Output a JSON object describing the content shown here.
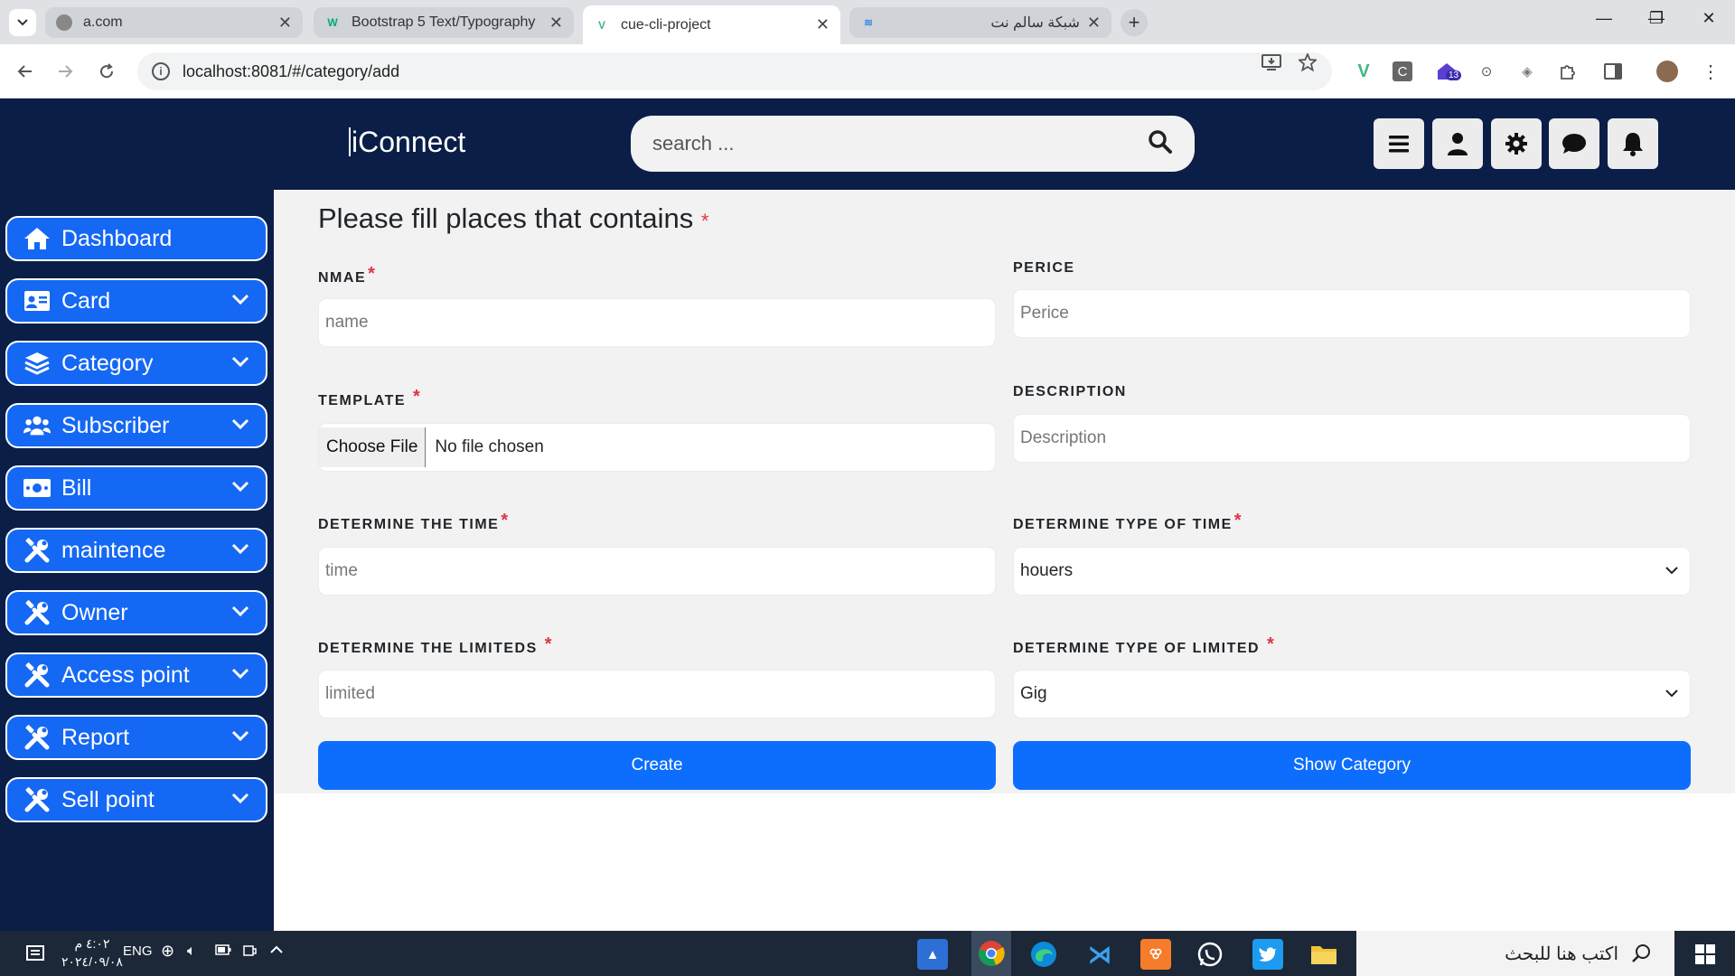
{
  "browser": {
    "tabs": [
      {
        "title": "a.com",
        "active": false,
        "favicon": "globe-icon"
      },
      {
        "title": "Bootstrap 5 Text/Typography",
        "active": false,
        "favicon": "w3schools-icon"
      },
      {
        "title": "cue-cli-project",
        "active": true,
        "favicon": "vue-icon"
      },
      {
        "title": "شبكة سالم نت",
        "active": false,
        "favicon": "wifi-icon"
      }
    ],
    "url": "localhost:8081/#/category/add",
    "extension_badge": "13"
  },
  "header": {
    "brand": "iConnect",
    "search_placeholder": "search ...",
    "buttons": [
      "menu-icon",
      "user-icon",
      "gear-icon",
      "chat-icon",
      "bell-icon"
    ]
  },
  "sidebar": {
    "items": [
      {
        "label": "Dashboard",
        "icon": "home-icon",
        "has_chevron": false
      },
      {
        "label": "Card",
        "icon": "id-card-icon",
        "has_chevron": true
      },
      {
        "label": "Category",
        "icon": "layers-icon",
        "has_chevron": true
      },
      {
        "label": "Subscriber",
        "icon": "users-icon",
        "has_chevron": true
      },
      {
        "label": "Bill",
        "icon": "money-icon",
        "has_chevron": true
      },
      {
        "label": "maintence",
        "icon": "tools-icon",
        "has_chevron": true
      },
      {
        "label": "Owner",
        "icon": "tools-icon",
        "has_chevron": true
      },
      {
        "label": "Access point",
        "icon": "tools-icon",
        "has_chevron": true
      },
      {
        "label": "Report",
        "icon": "tools-icon",
        "has_chevron": true
      },
      {
        "label": "Sell point",
        "icon": "tools-icon",
        "has_chevron": true
      }
    ]
  },
  "form": {
    "heading": "Please fill places that contains",
    "required_mark": "*",
    "fields": {
      "name": {
        "label": "NMAE",
        "placeholder": "name",
        "required": true
      },
      "price": {
        "label": "PERICE",
        "placeholder": "Perice",
        "required": false
      },
      "template": {
        "label": "TEMPLATE",
        "file_button": "Choose File",
        "file_status": "No file chosen",
        "required": true
      },
      "description": {
        "label": "DESCRIPTION",
        "placeholder": "Description",
        "required": false
      },
      "time": {
        "label": "DETERMINE THE TIME",
        "placeholder": "time",
        "required": true
      },
      "time_type": {
        "label": "DETERMINE TYPE OF TIME",
        "value": "houers",
        "required": true
      },
      "limited": {
        "label": "DETERMINE THE LIMITEDS",
        "placeholder": "limited",
        "required": true
      },
      "limited_type": {
        "label": "DETERMINE TYPE OF LIMITED",
        "value": "Gig",
        "required": true
      }
    },
    "create_label": "Create",
    "show_label": "Show Category"
  },
  "taskbar": {
    "time": "٤:٠٢ م",
    "date": "٢٠٢٤/٠٩/٠٨",
    "lang": "ENG",
    "search_text": "اكتب هنا للبحث"
  }
}
